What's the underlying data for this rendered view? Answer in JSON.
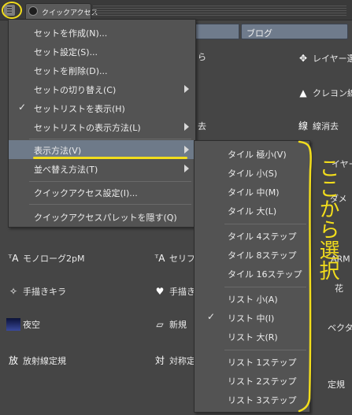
{
  "panel": {
    "tab_label": "クイックアクセス",
    "field_label": "ブログ"
  },
  "background_items": [
    {
      "label": "レイヤー選",
      "icon": "layer-select-icon"
    },
    {
      "label": "クレヨン線",
      "icon": "crayon-line-icon"
    },
    {
      "label": "線消去",
      "icon": "line-erase-icon"
    },
    {
      "label": "モノローグ2pM",
      "icon": "monologue-icon"
    },
    {
      "label": "セリフ",
      "icon": "speech-icon"
    },
    {
      "label": "手描きキラ",
      "icon": "sparkle-icon"
    },
    {
      "label": "手描き",
      "icon": "hearts-icon"
    },
    {
      "label": "夜空",
      "icon": "night-sky-thumbnail"
    },
    {
      "label": "新規",
      "icon": "new-folder-icon"
    },
    {
      "label": "放射線定規",
      "icon": "radial-ruler-icon"
    },
    {
      "label": "対称定",
      "icon": "symmetry-ruler-icon"
    },
    {
      "label": "ら",
      "icon": ""
    },
    {
      "label": "去",
      "icon": ""
    },
    {
      "label": "イヤー",
      "icon": ""
    },
    {
      "label": "ダメ",
      "icon": ""
    },
    {
      "label": "ARM",
      "icon": ""
    },
    {
      "label": "花",
      "icon": ""
    },
    {
      "label": "ベクター",
      "icon": ""
    },
    {
      "label": "定規",
      "icon": ""
    }
  ],
  "menu": {
    "items": [
      {
        "label": "セットを作成(N)..."
      },
      {
        "label": "セット設定(S)..."
      },
      {
        "label": "セットを削除(D)..."
      },
      {
        "label": "セットの切り替え(C)"
      },
      {
        "label": "セットリストを表示(H)",
        "checked": true,
        "check": "✓"
      },
      {
        "label": "セットリストの表示方法(L)"
      },
      {
        "label": "表示方法(V)"
      },
      {
        "label": "並べ替え方法(T)"
      },
      {
        "label": "クイックアクセス設定(I)..."
      },
      {
        "label": "クイックアクセスパレットを隠す(Q)"
      }
    ]
  },
  "submenu": {
    "items": [
      {
        "label": "タイル 極小(V)"
      },
      {
        "label": "タイル 小(S)"
      },
      {
        "label": "タイル 中(M)"
      },
      {
        "label": "タイル 大(L)"
      },
      {
        "label": "タイル 4ステップ"
      },
      {
        "label": "タイル 8ステップ"
      },
      {
        "label": "タイル 16ステップ"
      },
      {
        "label": "リスト 小(A)"
      },
      {
        "label": "リスト 中(I)",
        "checked": true,
        "check": "✓"
      },
      {
        "label": "リスト 大(R)"
      },
      {
        "label": "リスト 1ステップ"
      },
      {
        "label": "リスト 2ステップ"
      },
      {
        "label": "リスト 3ステップ"
      }
    ]
  },
  "annotation": {
    "text": "ここから選択",
    "color": "#f2dd1c"
  },
  "colors": {
    "highlight": "#6e7a89",
    "annotation": "#f2dd1c"
  }
}
